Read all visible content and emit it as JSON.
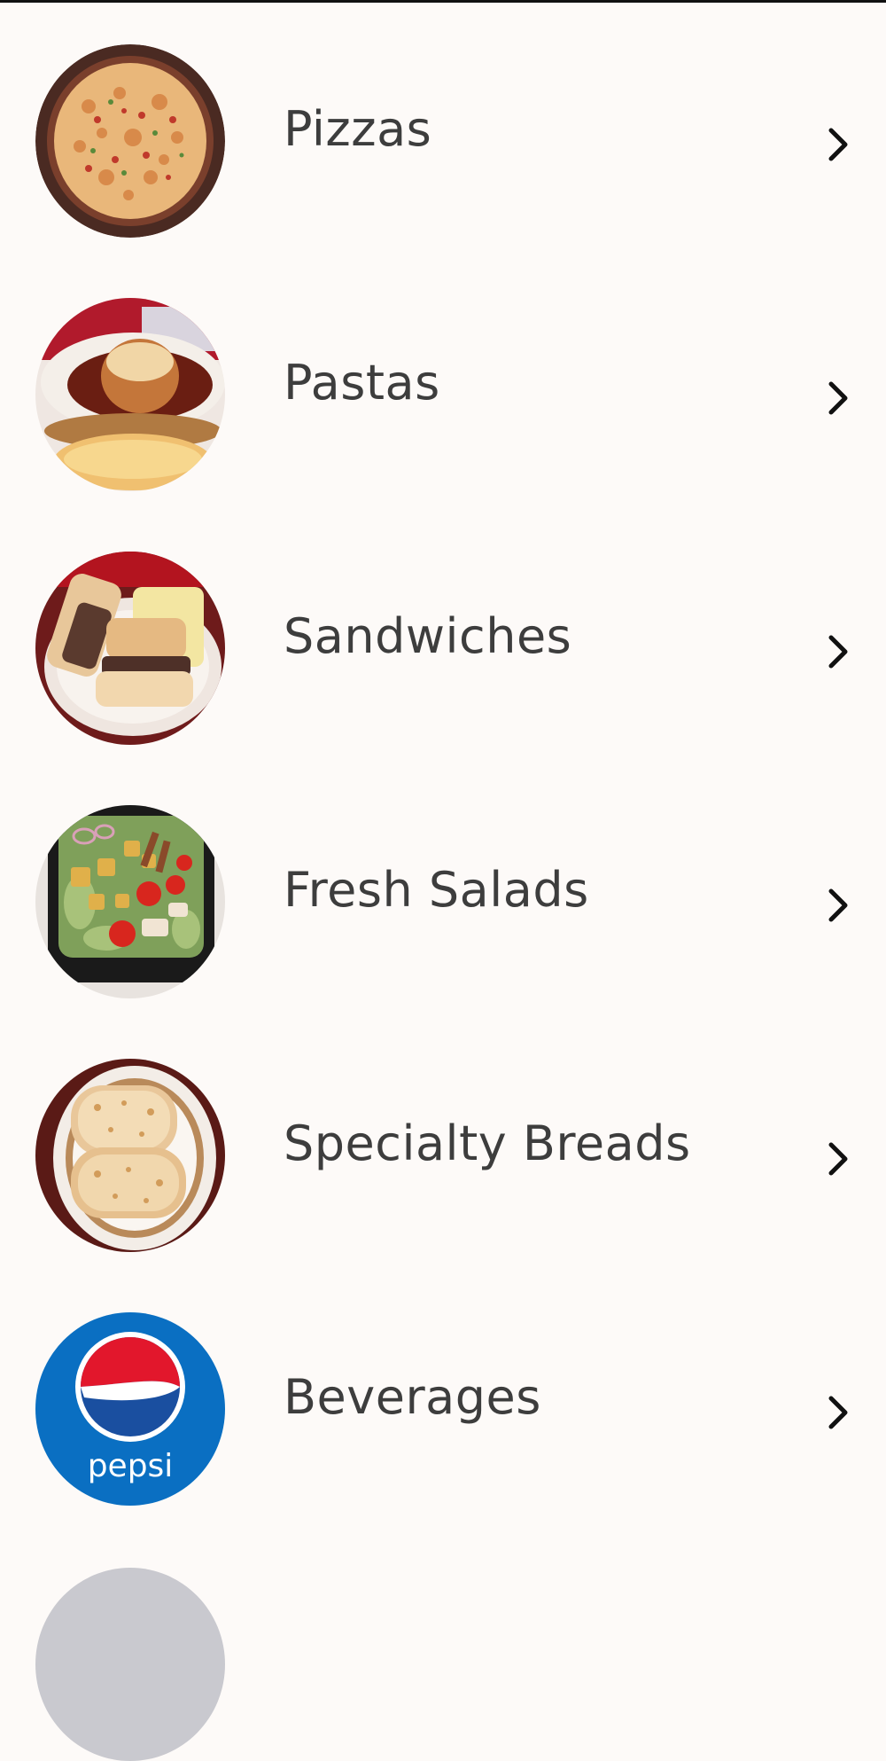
{
  "menu": {
    "categories": [
      {
        "label": "Pizzas",
        "icon": "pizza-photo-icon"
      },
      {
        "label": "Pastas",
        "icon": "pasta-photo-icon"
      },
      {
        "label": "Sandwiches",
        "icon": "sandwich-photo-icon"
      },
      {
        "label": "Fresh Salads",
        "icon": "salad-photo-icon"
      },
      {
        "label": "Specialty Breads",
        "icon": "bread-photo-icon"
      },
      {
        "label": "Beverages",
        "icon": "pepsi-logo-icon"
      }
    ],
    "chevron_icon": "chevron-right-icon",
    "beverage_logo_text": "pepsi"
  },
  "colors": {
    "background": "#fdfaf8",
    "label_text": "#3d3d3d",
    "chevron": "#111111",
    "pepsi_blue": "#0a6fc2",
    "pepsi_red": "#e2172c"
  }
}
